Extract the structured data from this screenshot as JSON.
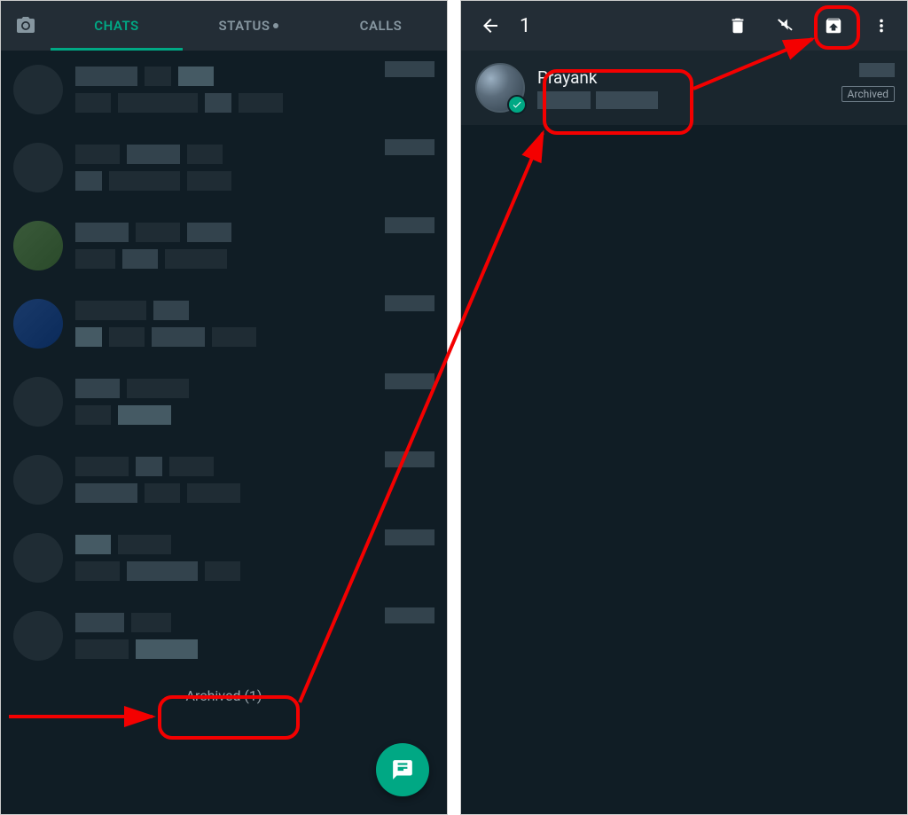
{
  "left": {
    "tabs": {
      "chats": "CHATS",
      "status": "STATUS",
      "calls": "CALLS"
    },
    "archived_label": "Archived (1)"
  },
  "right": {
    "selection_count": "1",
    "chat": {
      "name": "Prayank",
      "archived_badge": "Archived"
    }
  }
}
